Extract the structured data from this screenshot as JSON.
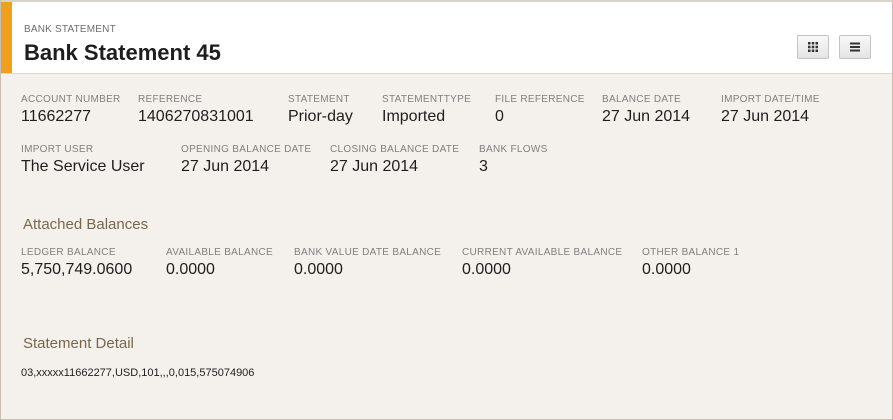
{
  "header": {
    "kicker": "BANK STATEMENT",
    "title": "Bank Statement 45",
    "accent_color": "#f0a01e",
    "grid_view_icon": "grid-icon",
    "list_view_icon": "list-icon"
  },
  "details": {
    "account_number": {
      "label": "ACCOUNT NUMBER",
      "value": "11662277"
    },
    "reference": {
      "label": "REFERENCE",
      "value": "1406270831001"
    },
    "statement": {
      "label": "STATEMENT",
      "value": "Prior-day"
    },
    "statement_type": {
      "label": "STATEMENTTYPE",
      "value": "Imported"
    },
    "file_reference": {
      "label": "FILE REFERENCE",
      "value": "0"
    },
    "balance_date": {
      "label": "BALANCE DATE",
      "value": "27 Jun 2014"
    },
    "import_datetime": {
      "label": "IMPORT DATE/TIME",
      "value": "27 Jun 2014"
    },
    "import_user": {
      "label": "IMPORT USER",
      "value": "The Service User"
    },
    "opening_balance_date": {
      "label": "OPENING BALANCE DATE",
      "value": "27 Jun 2014"
    },
    "closing_balance_date": {
      "label": "CLOSING BALANCE DATE",
      "value": "27 Jun 2014"
    },
    "bank_flows": {
      "label": "BANK FLOWS",
      "value": "3"
    }
  },
  "attached_balances": {
    "heading": "Attached Balances",
    "ledger_balance": {
      "label": "LEDGER BALANCE",
      "value": "5,750,749.0600"
    },
    "available_balance": {
      "label": "AVAILABLE BALANCE",
      "value": "0.0000"
    },
    "bank_value_date_balance": {
      "label": "BANK VALUE DATE BALANCE",
      "value": "0.0000"
    },
    "current_available_balance": {
      "label": "CURRENT AVAILABLE BALANCE",
      "value": "0.0000"
    },
    "other_balance_1": {
      "label": "OTHER BALANCE 1",
      "value": "0.0000"
    }
  },
  "statement_detail": {
    "heading": "Statement Detail",
    "text": "03,xxxxx11662277,USD,101,,,0,015,575074906"
  }
}
